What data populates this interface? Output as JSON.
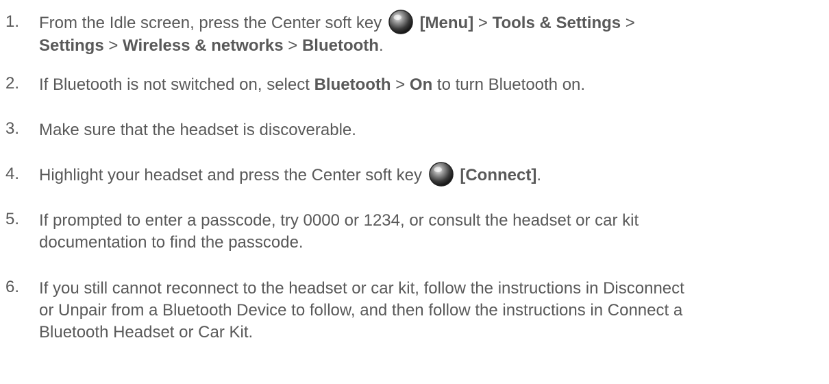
{
  "steps": [
    {
      "number": "1.",
      "text_a": "From the Idle screen, press the Center soft key ",
      "icon": "center-soft-key-icon",
      "menu": "[Menu]",
      "sep1": " > ",
      "tools_settings": "Tools & Settings",
      "sep2": " >",
      "settings": "Settings",
      "sep3": " > ",
      "wireless": "Wireless & networks",
      "sep4": " > ",
      "bluetooth": "Bluetooth",
      "end": "."
    },
    {
      "number": "2.",
      "text_a": "If Bluetooth is not switched on, select ",
      "bluetooth": "Bluetooth",
      "sep": " > ",
      "on": "On",
      "text_b": " to turn Bluetooth on."
    },
    {
      "number": "3.",
      "text": "Make sure that the headset is discoverable."
    },
    {
      "number": "4.",
      "text_a": "Highlight your headset and press the Center soft key ",
      "icon": "center-soft-key-icon",
      "connect": "[Connect]",
      "end": "."
    },
    {
      "number": "5.",
      "line1": "If prompted to enter a passcode, try 0000 or 1234, or consult the headset or car kit",
      "line2": "documentation to find the passcode."
    },
    {
      "number": "6.",
      "line1": "If you still cannot reconnect to the headset or car kit, follow the instructions in Disconnect",
      "line2": "or Unpair from a Bluetooth Device to follow, and then follow the instructions in Connect a",
      "line3": "Bluetooth Headset or Car Kit."
    }
  ]
}
